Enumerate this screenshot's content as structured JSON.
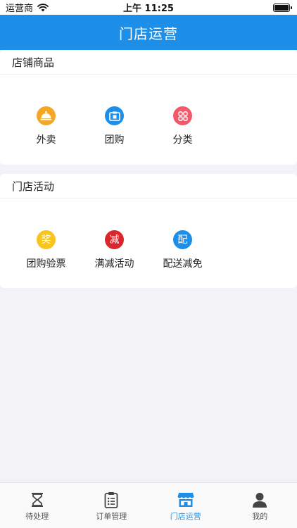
{
  "status_bar": {
    "carrier": "运营商",
    "time": "上午 11:25",
    "battery_level": 1.0
  },
  "nav": {
    "title": "门店运营"
  },
  "store_products": {
    "header": "店铺商品",
    "items": [
      {
        "label": "外卖",
        "icon": "cloche-icon",
        "color": "#f5a623"
      },
      {
        "label": "团购",
        "icon": "group-buy-icon",
        "color": "#1e8fe8"
      },
      {
        "label": "分类",
        "icon": "category-grid-icon",
        "color": "#f25a6b"
      }
    ]
  },
  "store_activities": {
    "header": "门店活动",
    "items": [
      {
        "label": "团购验票",
        "icon_text": "奖",
        "color": "#f7c51e"
      },
      {
        "label": "满减活动",
        "icon_text": "减",
        "color": "#d9262c"
      },
      {
        "label": "配送减免",
        "icon_text": "配",
        "color": "#1e8fe8"
      }
    ]
  },
  "tab_bar": {
    "active_color": "#1e8fe8",
    "tabs": [
      {
        "label": "待处理",
        "icon": "hourglass-icon",
        "active": false
      },
      {
        "label": "订单管理",
        "icon": "clipboard-icon",
        "active": false
      },
      {
        "label": "门店运营",
        "icon": "storefront-icon",
        "active": true
      },
      {
        "label": "我的",
        "icon": "user-icon",
        "active": false
      }
    ]
  }
}
